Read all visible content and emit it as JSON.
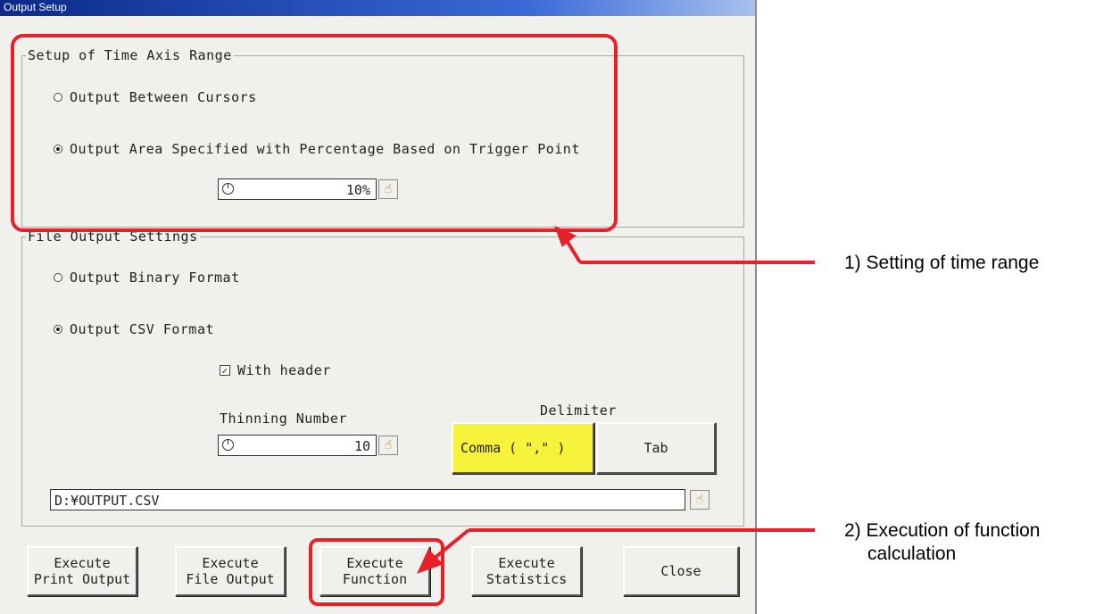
{
  "window": {
    "title": "Output Setup"
  },
  "time_axis": {
    "legend": "Setup of Time Axis Range",
    "option_cursors": {
      "label": "Output Between Cursors",
      "selected": false
    },
    "option_percentage": {
      "label": "Output Area Specified with Percentage Based on Trigger Point",
      "selected": true
    },
    "percentage_value": "10%"
  },
  "file_output": {
    "legend": "File Output Settings",
    "option_binary": {
      "label": "Output Binary Format",
      "selected": false
    },
    "option_csv": {
      "label": "Output CSV Format",
      "selected": true
    },
    "with_header": {
      "label": "With header",
      "checked": true
    },
    "thinning_label": "Thinning Number",
    "thinning_value": "10",
    "delimiter_label": "Delimiter",
    "delimiter_comma": "Comma ( \",\" )",
    "delimiter_tab": "Tab",
    "delimiter_selected": "comma",
    "path": "D:¥OUTPUT.CSV"
  },
  "buttons": {
    "print": {
      "line1": "Execute",
      "line2": "Print Output"
    },
    "file": {
      "line1": "Execute",
      "line2": "File Output"
    },
    "function": {
      "line1": "Execute",
      "line2": "Function"
    },
    "statistics": {
      "line1": "Execute",
      "line2": "Statistics"
    },
    "close": "Close"
  },
  "annotations": {
    "time_range": "1) Setting of time range",
    "function_line1": "2) Execution of function",
    "function_line2": "calculation"
  },
  "colors": {
    "highlight": "#f7f23a",
    "annotation_red": "#e8202a",
    "title_bar": "#0b2a8a"
  },
  "icons": {
    "hand": "pointing-hand-icon",
    "knob": "dial-knob-icon"
  }
}
